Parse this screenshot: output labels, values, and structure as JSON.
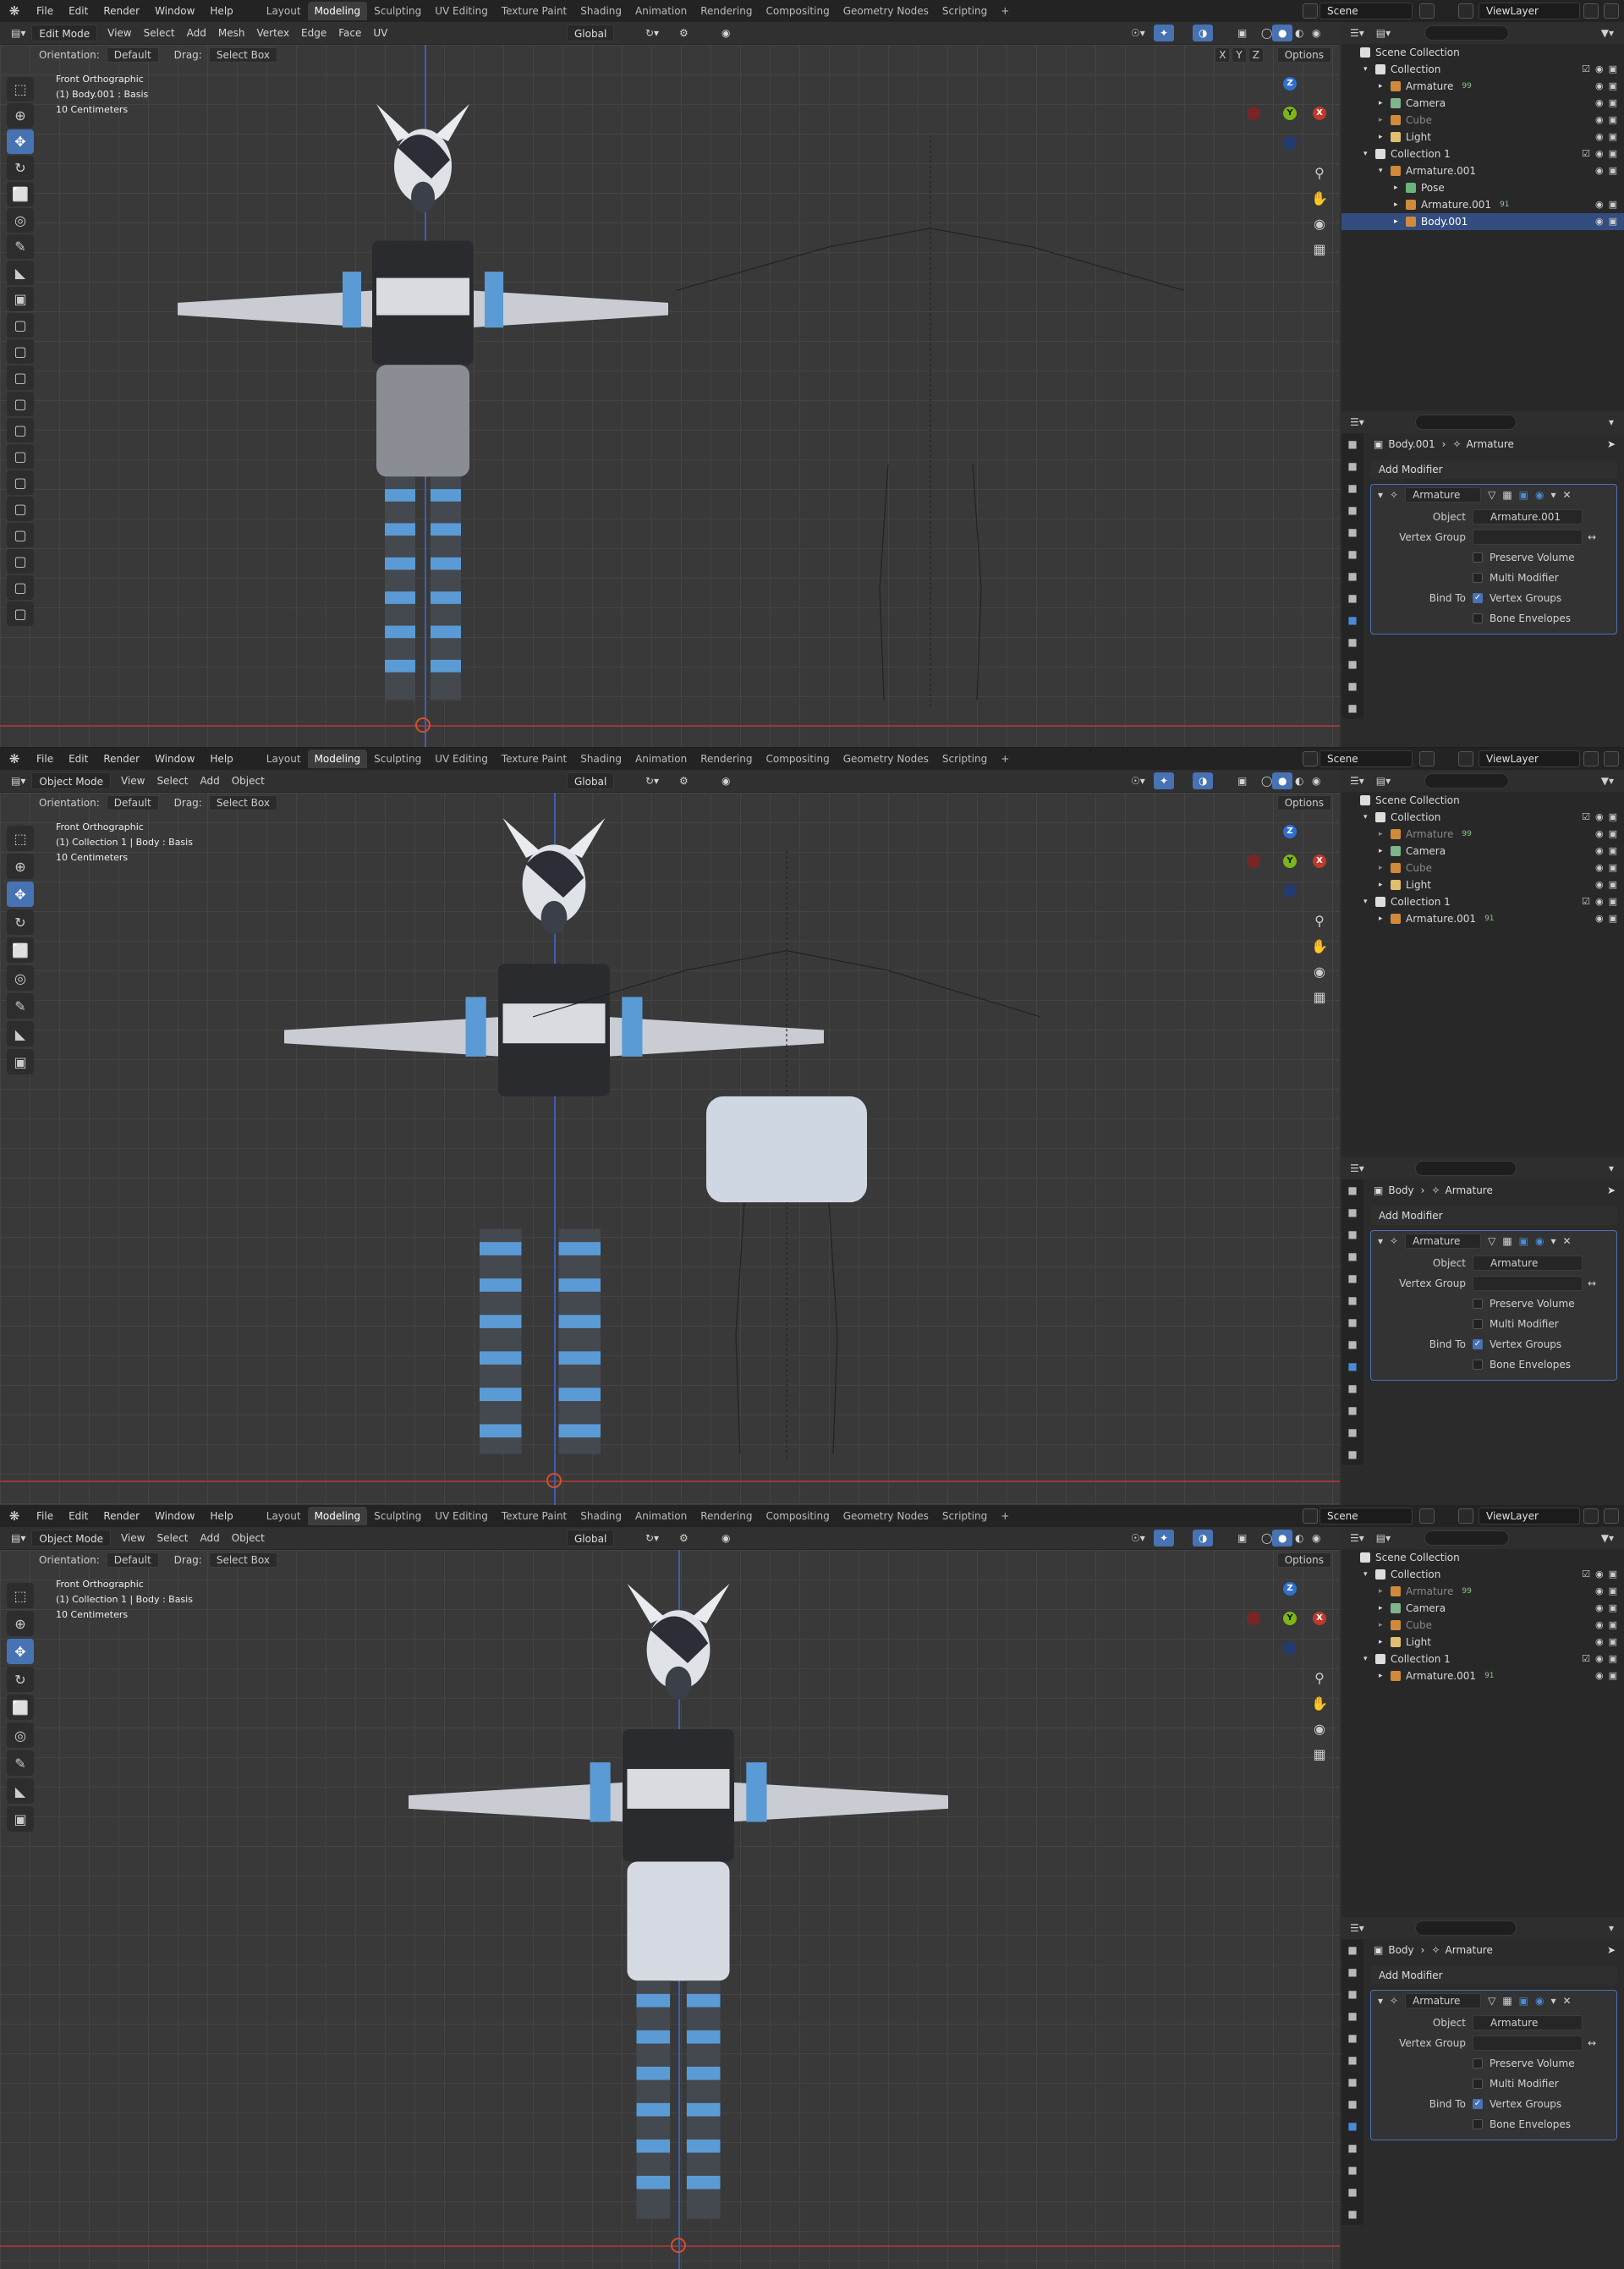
{
  "menu": {
    "file": "File",
    "edit": "Edit",
    "render": "Render",
    "window": "Window",
    "help": "Help"
  },
  "workspaces": [
    "Layout",
    "Modeling",
    "Sculpting",
    "UV Editing",
    "Texture Paint",
    "Shading",
    "Animation",
    "Rendering",
    "Compositing",
    "Geometry Nodes",
    "Scripting"
  ],
  "workspace_add": "+",
  "scene": "Scene",
  "view_layer": "ViewLayer",
  "options_label": "Options",
  "orientation_label": "Orientation:",
  "orientation_value": "Default",
  "drag_label": "Drag:",
  "drag_value": "Select Box",
  "transform_value": "Global",
  "modifier": {
    "add_label": "Add Modifier",
    "name": "Armature",
    "object_label": "Object",
    "vgroup_label": "Vertex Group",
    "preserve": "Preserve Volume",
    "multi": "Multi Modifier",
    "bindto": "Bind To",
    "vgroups": "Vertex Groups",
    "envelopes": "Bone Envelopes"
  },
  "panels": [
    {
      "mode": "Edit Mode",
      "header_items": [
        "View",
        "Select",
        "Add",
        "Mesh",
        "Vertex",
        "Edge",
        "Face",
        "UV"
      ],
      "info": [
        "Front Orthographic",
        "(1) Body.001 : Basis",
        "10 Centimeters"
      ],
      "axes": [
        "X",
        "Y",
        "Z"
      ],
      "crumb_object": "Body.001",
      "crumb_mod": "Armature",
      "mod_object": "Armature.001",
      "outliner": [
        {
          "label": "Scene Collection",
          "indent": 0,
          "type": "scene"
        },
        {
          "label": "Collection",
          "indent": 1,
          "type": "coll"
        },
        {
          "label": "Armature",
          "indent": 2,
          "type": "arm",
          "badge": "99"
        },
        {
          "label": "Camera",
          "indent": 2,
          "type": "cam"
        },
        {
          "label": "Cube",
          "indent": 2,
          "type": "mesh",
          "dim": true
        },
        {
          "label": "Light",
          "indent": 2,
          "type": "light"
        },
        {
          "label": "Collection 1",
          "indent": 1,
          "type": "coll"
        },
        {
          "label": "Armature.001",
          "indent": 2,
          "type": "arm"
        },
        {
          "label": "Pose",
          "indent": 3,
          "type": "pose"
        },
        {
          "label": "Armature.001",
          "indent": 3,
          "type": "arm",
          "badge": "91"
        },
        {
          "label": "Body.001",
          "indent": 3,
          "type": "mesh",
          "sel": true
        }
      ]
    },
    {
      "mode": "Object Mode",
      "header_items": [
        "View",
        "Select",
        "Add",
        "Object"
      ],
      "info": [
        "Front Orthographic",
        "(1) Collection 1 | Body : Basis",
        "10 Centimeters"
      ],
      "crumb_object": "Body",
      "crumb_mod": "Armature",
      "mod_object": "Armature",
      "outliner": [
        {
          "label": "Scene Collection",
          "indent": 0,
          "type": "scene"
        },
        {
          "label": "Collection",
          "indent": 1,
          "type": "coll"
        },
        {
          "label": "Armature",
          "indent": 2,
          "type": "arm",
          "badge": "99",
          "dim": true
        },
        {
          "label": "Camera",
          "indent": 2,
          "type": "cam"
        },
        {
          "label": "Cube",
          "indent": 2,
          "type": "mesh",
          "dim": true
        },
        {
          "label": "Light",
          "indent": 2,
          "type": "light"
        },
        {
          "label": "Collection 1",
          "indent": 1,
          "type": "coll"
        },
        {
          "label": "Armature.001",
          "indent": 2,
          "type": "arm",
          "badge": "91"
        }
      ]
    },
    {
      "mode": "Object Mode",
      "header_items": [
        "View",
        "Select",
        "Add",
        "Object"
      ],
      "info": [
        "Front Orthographic",
        "(1) Collection 1 | Body : Basis",
        "10 Centimeters"
      ],
      "crumb_object": "Body",
      "crumb_mod": "Armature",
      "mod_object": "Armature",
      "outliner": [
        {
          "label": "Scene Collection",
          "indent": 0,
          "type": "scene"
        },
        {
          "label": "Collection",
          "indent": 1,
          "type": "coll"
        },
        {
          "label": "Armature",
          "indent": 2,
          "type": "arm",
          "badge": "99",
          "dim": true
        },
        {
          "label": "Camera",
          "indent": 2,
          "type": "cam"
        },
        {
          "label": "Cube",
          "indent": 2,
          "type": "mesh",
          "dim": true
        },
        {
          "label": "Light",
          "indent": 2,
          "type": "light"
        },
        {
          "label": "Collection 1",
          "indent": 1,
          "type": "coll"
        },
        {
          "label": "Armature.001",
          "indent": 2,
          "type": "arm",
          "badge": "91"
        }
      ]
    }
  ],
  "colors": {
    "accent": "#4772b3",
    "selected_row": "#334d80",
    "x_axis": "#c0392b",
    "y_axis": "#7cb518",
    "z_axis": "#2f6fd0"
  }
}
